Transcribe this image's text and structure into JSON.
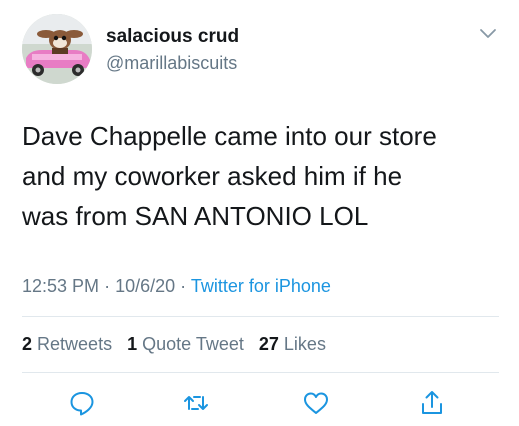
{
  "author": {
    "display_name": "salacious crud",
    "handle": "@marillabiscuits",
    "avatar_icon": "avatar-gremlin-pink-car"
  },
  "tweet": {
    "lines": [
      "Dave Chappelle came into our store",
      "and my coworker asked him if he",
      "was from SAN ANTONIO LOL"
    ],
    "time": "12:53 PM",
    "date": "10/6/20",
    "separator": "·",
    "source": "Twitter for iPhone"
  },
  "stats": {
    "retweets_count": "2",
    "retweets_label": "Retweets",
    "quotes_count": "1",
    "quotes_label": "Quote Tweet",
    "likes_count": "27",
    "likes_label": "Likes"
  },
  "actions": {
    "icons": [
      "reply-icon",
      "retweet-icon",
      "like-icon",
      "share-icon"
    ]
  },
  "colors": {
    "text": "#14171a",
    "secondary": "#657786",
    "link": "#1b95e0",
    "divider": "#e1e8ed",
    "icon": "#1b95e0"
  }
}
